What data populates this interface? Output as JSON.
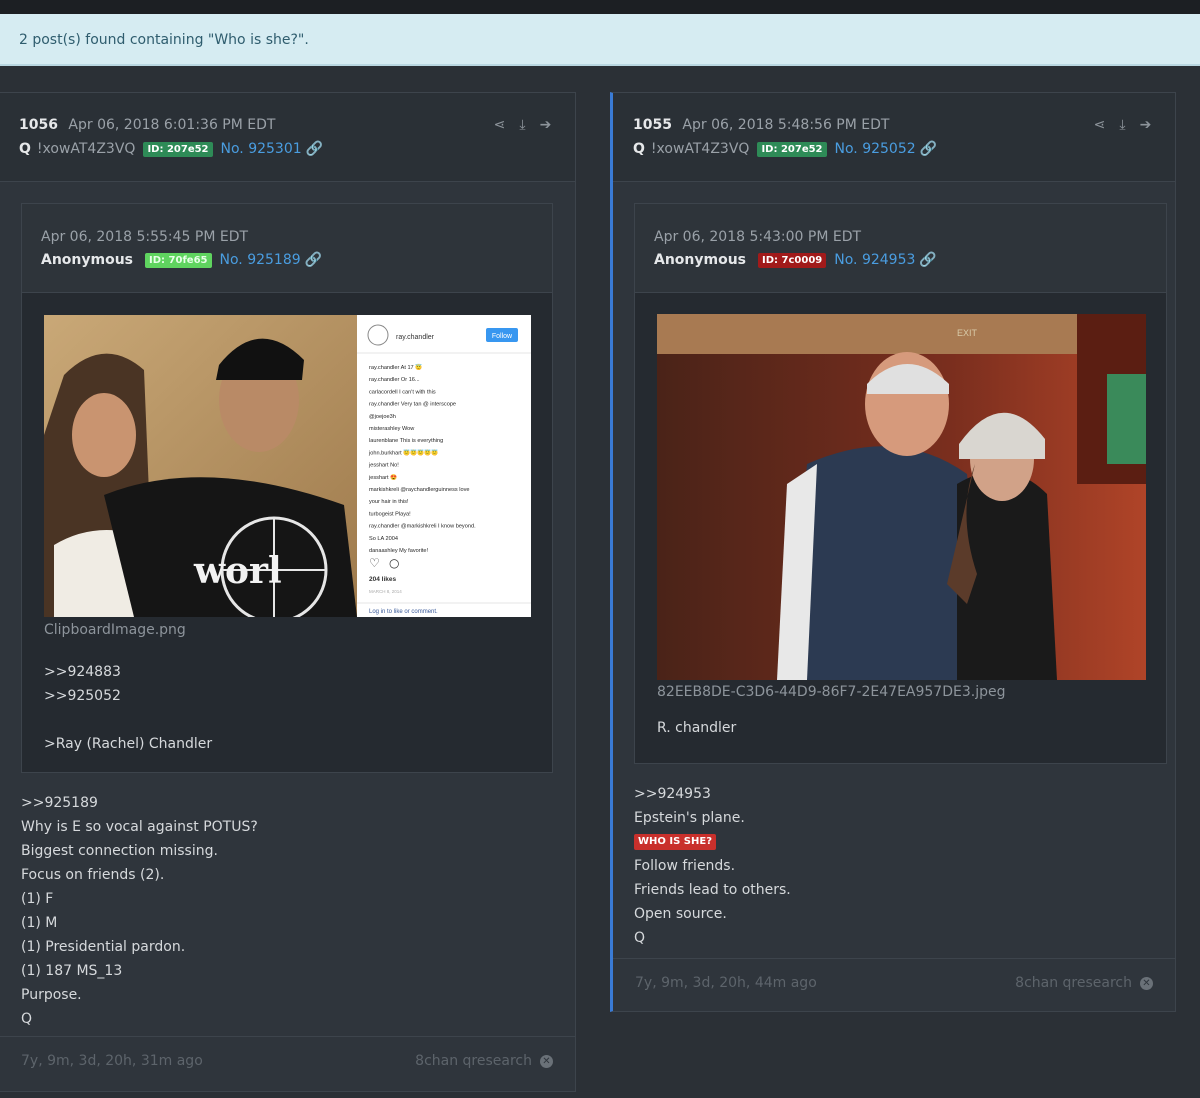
{
  "banner": {
    "text": "2 post(s) found containing \"Who is she?\"."
  },
  "posts": [
    {
      "number": "1056",
      "date": "Apr 06, 2018 6:01:36 PM EDT",
      "author": "Q",
      "trip": "!xowAT4Z3VQ",
      "id": "ID: 207e52",
      "post_no": "No. 925301",
      "quote": {
        "date": "Apr 06, 2018 5:55:45 PM EDT",
        "author": "Anonymous",
        "id": "ID: 70fe65",
        "post_no": "No. 925189",
        "filename": "ClipboardImage.png",
        "lines": [
          ">>924883",
          ">>925052",
          "",
          ">Ray (Rachel) Chandler"
        ]
      },
      "lines": [
        ">>925189",
        "Why is E so vocal against POTUS?",
        "Biggest connection missing.",
        "Focus on friends (2).",
        "(1) F",
        "(1) M",
        "(1) Presidential pardon.",
        "(1) 187 MS_13",
        "Purpose.",
        "Q"
      ],
      "ago": "7y, 9m, 3d, 20h, 31m ago",
      "source": "8chan qresearch"
    },
    {
      "number": "1055",
      "date": "Apr 06, 2018 5:48:56 PM EDT",
      "author": "Q",
      "trip": "!xowAT4Z3VQ",
      "id": "ID: 207e52",
      "post_no": "No. 925052",
      "quote": {
        "date": "Apr 06, 2018 5:43:00 PM EDT",
        "author": "Anonymous",
        "id": "ID: 7c0009",
        "post_no": "No. 924953",
        "filename": "82EEB8DE-C3D6-44D9-86F7-2E47EA957DE3.jpeg",
        "lines": [
          "R. chandler"
        ]
      },
      "lines_before_tag": [
        ">>924953",
        "Epstein's plane."
      ],
      "tag": "WHO IS SHE?",
      "lines_after_tag": [
        "Follow friends.",
        "Friends lead to others.",
        "Open source.",
        "Q"
      ],
      "ago": "7y, 9m, 3d, 20h, 44m ago",
      "source": "8chan qresearch"
    }
  ],
  "instagram": {
    "username": "ray.chandler",
    "follow": "Follow",
    "comments": [
      "ray.chandler At 17 😇",
      "ray.chandler Or 16...",
      "carlacordell I can't with this",
      "ray.chandler Very tan @ interscope",
      "@joejoe3h",
      "misterashley Wow",
      "laurenblane This is everything",
      "john.burkhart 😇😇😇😇😇",
      "jesshart No!",
      "jesshart 😍",
      "markishkreli @raychandlerguinness love",
      "your hair in this!",
      "turbogeist Playa!",
      "ray.chandler @markishkreli I know beyond.",
      "So LA 2004",
      "danaashley My favorite!"
    ],
    "likes": "204 likes",
    "date": "MARCH 8, 2014",
    "login": "Log in to like or comment.",
    "shirt_text": "worl",
    "exit_sign": "EXIT"
  },
  "icons": [
    "share-icon",
    "download-icon",
    "forward-icon",
    "link-icon",
    "close-icon"
  ]
}
